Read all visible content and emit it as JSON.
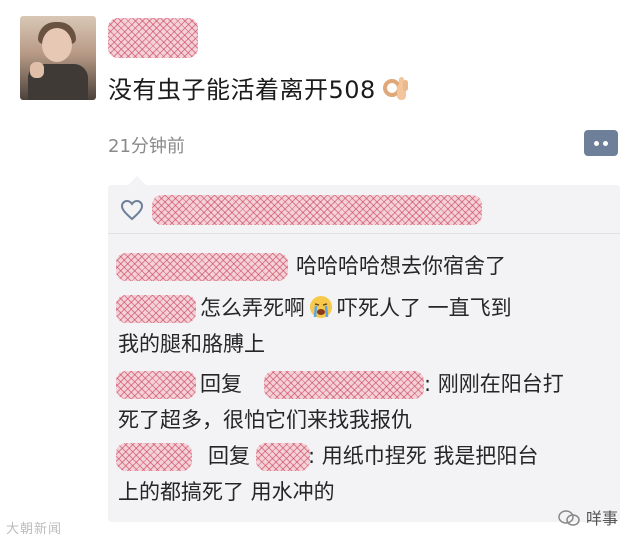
{
  "post": {
    "text": "没有虫子能活着离开508",
    "time": "21分钟前",
    "icons": {
      "emoji": "ok-hand-icon",
      "more": "more-dots-icon"
    }
  },
  "comments": {
    "like_icon": "heart-icon",
    "items": [
      {
        "text": "哈哈哈哈想去你宿舍了"
      },
      {
        "text_before": "怎么弄死啊",
        "emoji": "crying-face-icon",
        "text_after": "吓死人了 一直飞到",
        "continuation": "我的腿和胳膊上"
      },
      {
        "reply_word": "回复",
        "text": ": 刚刚在阳台打",
        "continuation": "死了超多，很怕它们来找我报仇"
      },
      {
        "reply_word": "回复",
        "text": ": 用纸巾捏死 我是把阳台",
        "continuation": "上的都搞死了 用水冲的"
      }
    ]
  },
  "watermarks": {
    "left": "大朝新闻",
    "right": "咩事",
    "right_icon": "wechat-logo-icon"
  },
  "colors": {
    "more_button": "#6d7f99",
    "comment_bg": "#f3f3f5",
    "time_text": "#8a8a8a"
  }
}
